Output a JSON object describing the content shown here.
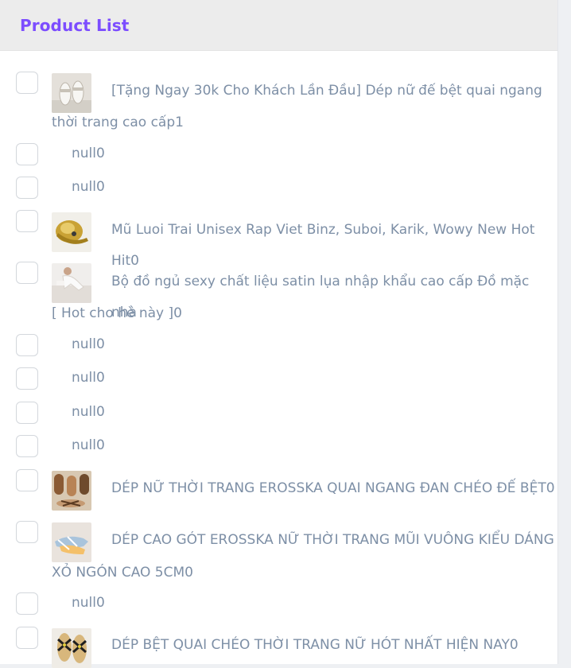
{
  "panel": {
    "title": "Product List"
  },
  "items": [
    {
      "name": "[Tặng Ngay 30k Cho Khách Lần Đầu] Dép nữ đế bệt quai ngang",
      "name2": "thời trang cao cấp1",
      "has_image": true
    },
    {
      "name": "null0",
      "has_image": false
    },
    {
      "name": "null0",
      "has_image": false
    },
    {
      "name": "Mũ Luoi Trai Unisex Rap Viet Binz, Suboi, Karik, Wowy New Hot Hit0",
      "has_image": true
    },
    {
      "name": "Bộ đồ ngủ sexy chất liệu satin lụa nhập khẩu cao cấp Đồ mặc nhà",
      "name2": "[ Hot cho hè này ]0",
      "has_image": true
    },
    {
      "name": "null0",
      "has_image": false
    },
    {
      "name": "null0",
      "has_image": false
    },
    {
      "name": "null0",
      "has_image": false
    },
    {
      "name": "null0",
      "has_image": false
    },
    {
      "name": "DÉP NỮ THỜI TRANG EROSSKA QUAI NGANG ĐAN CHÉO ĐẾ BỆT0",
      "has_image": true
    },
    {
      "name": "DÉP CAO GÓT EROSSKA NỮ THỜI TRANG MŨI VUÔNG KIỂU DÁNG",
      "name2": "XỎ NGÓN CAO 5CM0",
      "has_image": true
    },
    {
      "name": "null0",
      "has_image": false
    },
    {
      "name": "DÉP BỆT QUAI CHÉO THỜI TRANG NỮ HÓT NHẤT HIỆN NAY0",
      "has_image": true
    }
  ]
}
